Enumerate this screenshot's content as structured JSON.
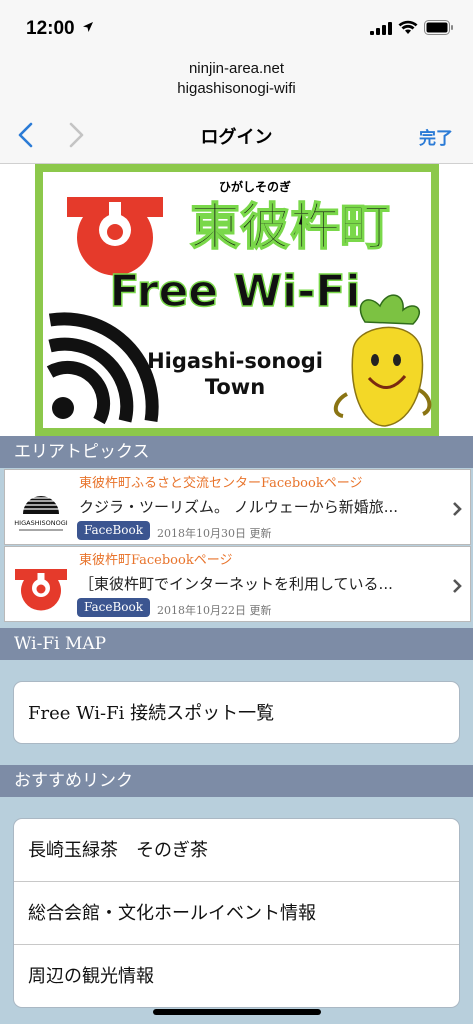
{
  "status": {
    "time": "12:00",
    "icons": [
      "location-arrow-icon",
      "cellular-signal-icon",
      "wifi-icon",
      "battery-icon"
    ]
  },
  "browser": {
    "domain": "ninjin-area.net",
    "path": "higashisonogi-wifi",
    "title": "ログイン",
    "done": "完了",
    "accent": "#2b7bd6"
  },
  "banner": {
    "hiragana": "ひがしそのぎ",
    "town_kanji": "東彼杵町",
    "free_wifi": "Free Wi-Fi",
    "town_en_1": "Higashi-sonogi",
    "town_en_2": "Town",
    "border_color": "#8cc84b"
  },
  "topics": {
    "header": "エリアトピックス",
    "items": [
      {
        "source": "東彼杵町ふるさと交流センターFacebookページ",
        "text": "クジラ・ツーリズム。 ノルウェーから新婚旅...",
        "badge": "FaceBook",
        "date": "2018年10月30日 更新",
        "thumb_label": "HIGASHISONOGI"
      },
      {
        "source": "東彼杵町Facebookページ",
        "text": "［東彼杵町でインターネットを利用している...",
        "badge": "FaceBook",
        "date": "2018年10月22日 更新"
      }
    ]
  },
  "wifimap": {
    "header": "Wi-Fi MAP",
    "items": [
      "Free Wi-Fi 接続スポット一覧"
    ]
  },
  "links": {
    "header": "おすすめリンク",
    "items": [
      "長崎玉緑茶　そのぎ茶",
      "総合会館・文化ホールイベント情報",
      "周辺の観光情報"
    ]
  },
  "colors": {
    "section_header": "#7d8ca6",
    "source_text": "#e8742c",
    "badge": "#3b5590",
    "logo_red": "#e53a2b"
  }
}
